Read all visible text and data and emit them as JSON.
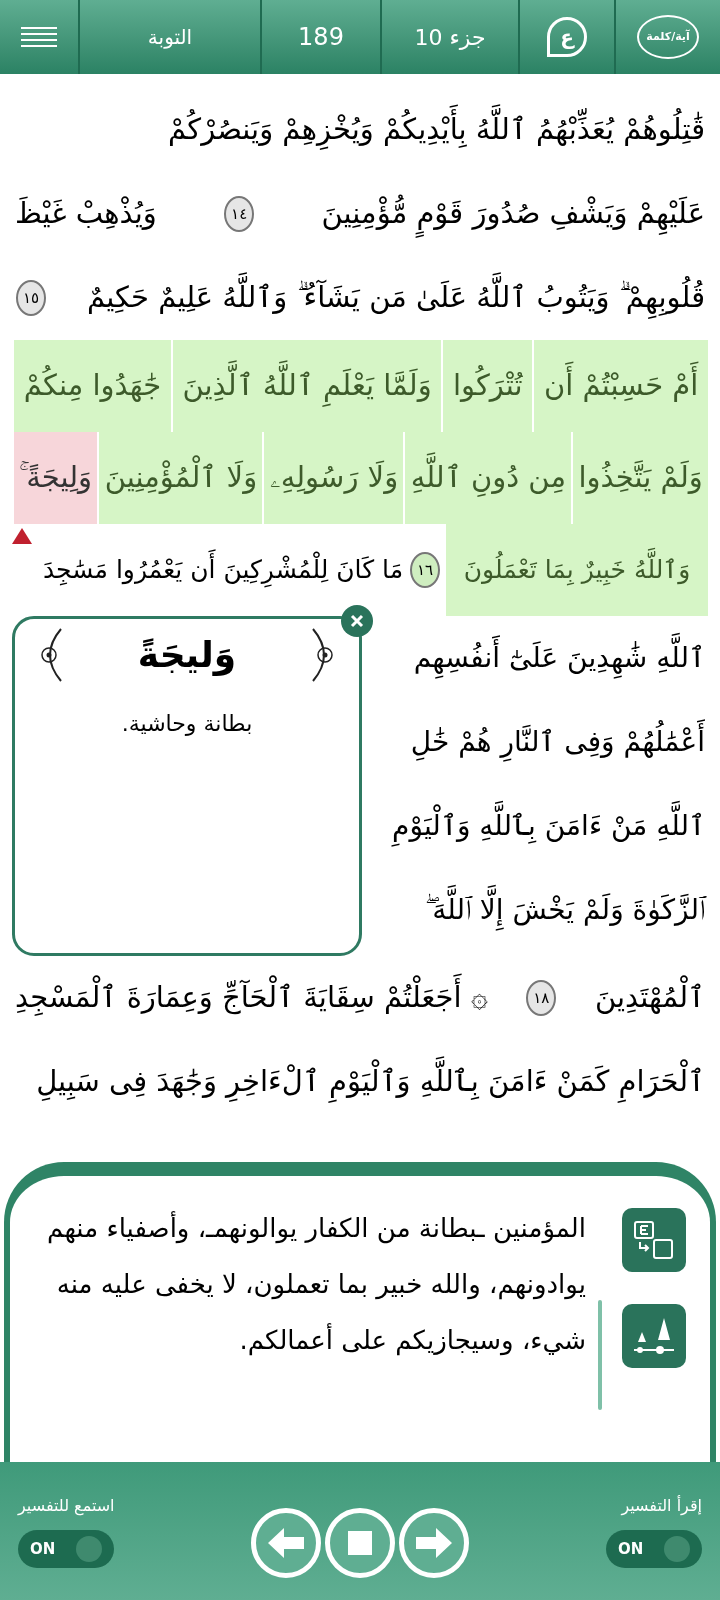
{
  "top_bar": {
    "mode_label": "آية/كلمة",
    "letter_badge": "ع",
    "juz": "جزء 10",
    "page": "189",
    "surah": "التوبة"
  },
  "lines": [
    {
      "parts": [
        {
          "kind": "text",
          "text": "قَٰتِلُوهُمْ يُعَذِّبْهُمُ ٱللَّهُ بِأَيْدِيكُمْ وَيُخْزِهِمْ وَيَنصُرْكُمْ",
          "highlighted": false,
          "selected": false
        }
      ]
    },
    {
      "parts": [
        {
          "kind": "text",
          "text": "عَلَيْهِمْ وَيَشْفِ صُدُورَ قَوْمٍ مُّؤْمِنِينَ",
          "highlighted": false,
          "selected": false
        },
        {
          "kind": "marker",
          "text": "١٤",
          "highlighted": false
        },
        {
          "kind": "text",
          "text": "وَيُذْهِبْ غَيْظَ",
          "highlighted": false,
          "selected": false
        }
      ]
    },
    {
      "parts": [
        {
          "kind": "text",
          "text": "قُلُوبِهِمْ ۗ وَيَتُوبُ ٱللَّهُ عَلَىٰ مَن يَشَآءُ ۗ وَٱللَّهُ عَلِيمٌ حَكِيمٌ",
          "highlighted": false,
          "selected": false
        },
        {
          "kind": "marker",
          "text": "١٥",
          "highlighted": false
        }
      ]
    },
    {
      "parts": [
        {
          "kind": "text",
          "text": "أَمْ حَسِبْتُمْ أَن",
          "highlighted": true,
          "selected": false
        },
        {
          "kind": "text",
          "text": "تُتْرَكُوا",
          "highlighted": true,
          "selected": false
        },
        {
          "kind": "text",
          "text": "وَلَمَّا يَعْلَمِ ٱللَّهُ ٱلَّذِينَ",
          "highlighted": true,
          "selected": false
        },
        {
          "kind": "text",
          "text": "جَٰهَدُوا مِنكُمْ",
          "highlighted": true,
          "selected": false
        }
      ]
    },
    {
      "parts": [
        {
          "kind": "text",
          "text": "وَلَمْ يَتَّخِذُوا",
          "highlighted": true,
          "selected": false
        },
        {
          "kind": "text",
          "text": "مِن دُونِ ٱللَّهِ",
          "highlighted": true,
          "selected": false
        },
        {
          "kind": "text",
          "text": "وَلَا رَسُولِهِۦ",
          "highlighted": true,
          "selected": false
        },
        {
          "kind": "text",
          "text": "وَلَا ٱلْمُؤْمِنِينَ",
          "highlighted": true,
          "selected": false
        },
        {
          "kind": "text",
          "text": "وَلِيجَةً ۚ",
          "highlighted": true,
          "selected": true
        }
      ]
    },
    {
      "parts": [
        {
          "kind": "text",
          "text": "وَٱللَّهُ خَبِيرٌ بِمَا تَعْمَلُونَ",
          "highlighted": true,
          "selected": false
        },
        {
          "kind": "marker",
          "text": "١٦",
          "highlighted": true
        },
        {
          "kind": "text",
          "text": "مَا كَانَ لِلْمُشْرِكِينَ أَن يَعْمُرُوا مَسَٰجِدَ",
          "highlighted": false,
          "selected": false
        }
      ]
    },
    {
      "parts": [
        {
          "kind": "text",
          "text": "ٱللَّهِ شَٰهِدِينَ عَلَىٰٓ أَنفُسِهِم",
          "highlighted": false,
          "selected": false
        }
      ]
    },
    {
      "parts": [
        {
          "kind": "text",
          "text": "أَعْمَٰلُهُمْ وَفِى ٱلنَّارِ هُمْ خَٰلِ",
          "highlighted": false,
          "selected": false
        }
      ]
    },
    {
      "parts": [
        {
          "kind": "text",
          "text": "ٱللَّهِ مَنْ ءَامَنَ بِٱللَّهِ وَٱلْيَوْمِ",
          "highlighted": false,
          "selected": false
        }
      ]
    },
    {
      "parts": [
        {
          "kind": "text",
          "text": "ٱلزَّكَوٰةَ وَلَمْ يَخْشَ إِلَّا ٱللَّهَ ۖ",
          "highlighted": false,
          "selected": false
        }
      ]
    },
    {
      "parts": [
        {
          "kind": "text",
          "text": "ٱلْمُهْتَدِينَ",
          "highlighted": false,
          "selected": false
        },
        {
          "kind": "marker",
          "text": "١٨",
          "highlighted": false
        },
        {
          "kind": "text",
          "text": "۞ أَجَعَلْتُمْ سِقَايَةَ ٱلْحَآجِّ وَعِمَارَةَ ٱلْمَسْجِدِ",
          "highlighted": false,
          "selected": false
        }
      ]
    },
    {
      "parts": [
        {
          "kind": "text",
          "text": "ٱلْحَرَامِ كَمَنْ ءَامَنَ بِٱللَّهِ وَٱلْيَوْمِ ٱلْءَاخِرِ وَجَٰهَدَ فِى سَبِيلِ",
          "highlighted": false,
          "selected": false
        }
      ]
    }
  ],
  "word_popup": {
    "word": "وَليجَةً",
    "meaning": "بطانة وحاشية."
  },
  "tafsir": {
    "text": "المؤمنين ـبطانة من الكفار يوالونهمـ، وأصفياء منهم يوادونهم، والله خبير بما تعملون، لا يخفى عليه منه شيء، وسيجازيكم على أعمالكم."
  },
  "bottom_bar": {
    "listen": {
      "label": "استمع للتفسير",
      "toggle": "ON",
      "on": true
    },
    "read": {
      "label": "إقرأ التفسير",
      "toggle": "ON",
      "on": true
    }
  }
}
